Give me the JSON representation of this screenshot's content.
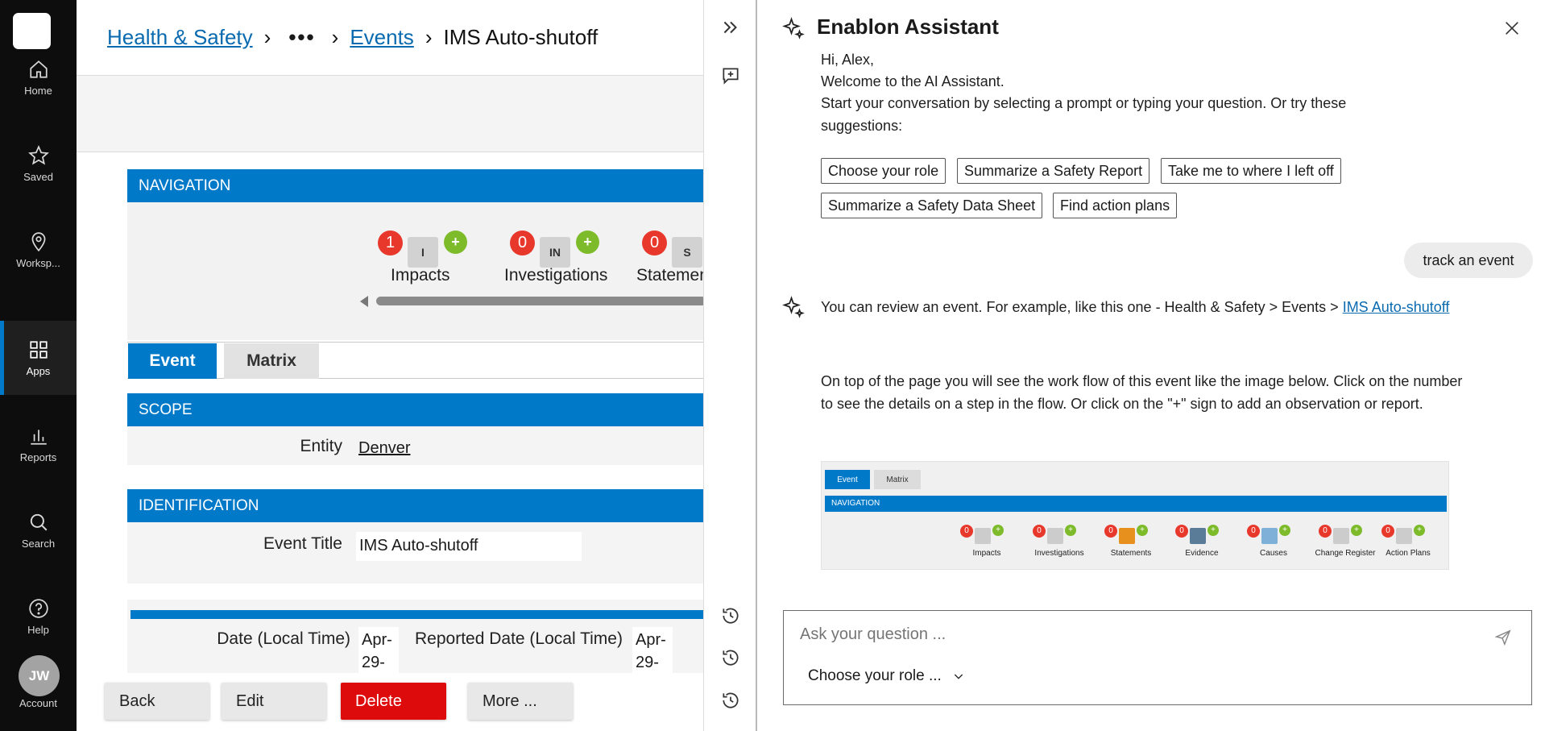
{
  "rail": {
    "items": [
      {
        "label": "Home",
        "icon": "home-icon"
      },
      {
        "label": "Saved",
        "icon": "star-icon"
      },
      {
        "label": "Worksp...",
        "icon": "location-pin-icon"
      },
      {
        "label": "Apps",
        "icon": "apps-grid-icon",
        "active": true
      },
      {
        "label": "Reports",
        "icon": "bar-chart-icon"
      },
      {
        "label": "Search",
        "icon": "search-icon"
      },
      {
        "label": "Help",
        "icon": "help-icon"
      }
    ],
    "account": {
      "initials": "JW",
      "label": "Account"
    }
  },
  "breadcrumb": {
    "root": "Health & Safety",
    "ellipsis": "•••",
    "events": "Events",
    "current": "IMS Auto-shutoff"
  },
  "navigation": {
    "title": "NAVIGATION",
    "steps": [
      {
        "count": "1",
        "icon_text": "I",
        "plus": "+",
        "label": "Impacts"
      },
      {
        "count": "0",
        "icon_text": "IN",
        "plus": "+",
        "label": "Investigations"
      },
      {
        "count": "0",
        "icon_text": "S",
        "plus": "+",
        "label": "Statements"
      }
    ]
  },
  "tabs": {
    "event": "Event",
    "matrix": "Matrix"
  },
  "scope": {
    "title": "SCOPE",
    "entity_label": "Entity",
    "entity_value": "Denver"
  },
  "identification": {
    "title": "IDENTIFICATION",
    "event_title_label": "Event Title",
    "event_title_value": "IMS Auto-shutoff"
  },
  "dates": {
    "date_label": "Date (Local Time)",
    "date_value": "Apr-29-",
    "reported_label": "Reported Date (Local Time)",
    "reported_value": "Apr-29-"
  },
  "actions": {
    "back": "Back",
    "edit": "Edit",
    "delete": "Delete",
    "more": "More ..."
  },
  "assistant": {
    "title": "Enablon Assistant",
    "greeting": "Hi, Alex,",
    "welcome": "Welcome to the AI Assistant.",
    "intro": "Start your conversation by selecting a prompt or typing your question. Or try these suggestions:",
    "suggestions": [
      "Choose your role",
      "Summarize a Safety Report",
      "Take me to where I left off",
      "Summarize a Safety Data Sheet",
      "Find action plans"
    ],
    "user_message": "track an event",
    "reply_prefix": "You can review an event. For example, like this one - Health & Safety > Events > ",
    "reply_link": "IMS Auto-shutoff",
    "reply_body": "On top of the page you will see the work flow of this event like the image below. Click on the number to see the details on a step in the flow. Or click on the \"+\" sign to add an observation or report.",
    "preview": {
      "tab_event": "Event",
      "tab_matrix": "Matrix",
      "bar": "NAVIGATION",
      "steps": [
        {
          "count": "0",
          "label": "Impacts"
        },
        {
          "count": "0",
          "label": "Investigations"
        },
        {
          "count": "0",
          "label": "Statements"
        },
        {
          "count": "0",
          "label": "Evidence"
        },
        {
          "count": "0",
          "label": "Causes"
        },
        {
          "count": "0",
          "label": "Change Register"
        },
        {
          "count": "0",
          "label": "Action Plans"
        }
      ],
      "plus": "+"
    },
    "input_placeholder": "Ask your question ...",
    "role_select": "Choose your role ..."
  },
  "colors": {
    "accent": "#0079c9",
    "danger": "#dd0b0b",
    "count_badge": "#e8382c",
    "plus_badge": "#7dbb2b",
    "rail": "#0d0d0d"
  }
}
